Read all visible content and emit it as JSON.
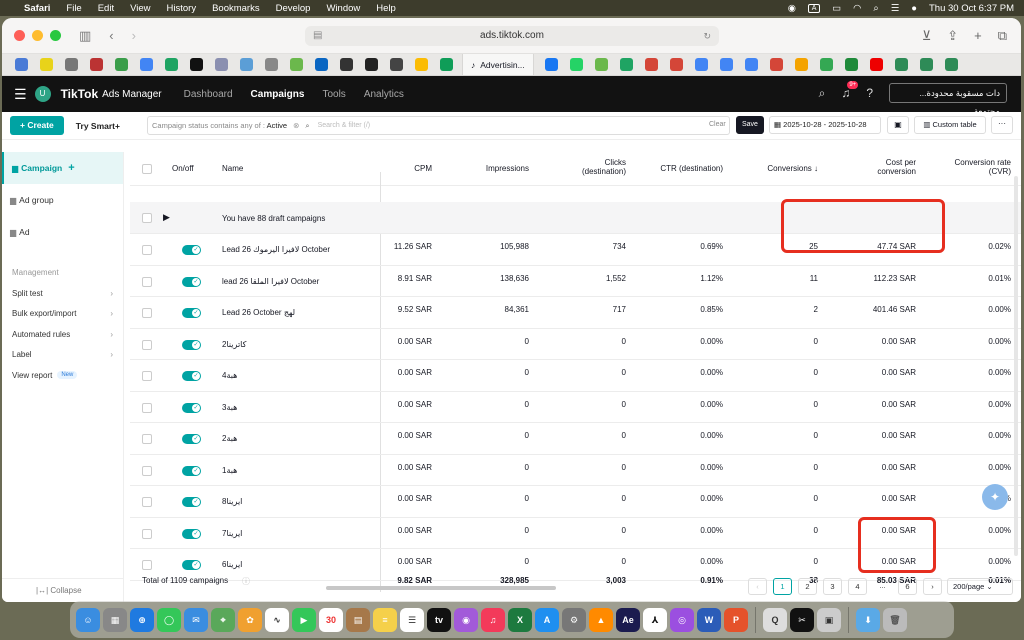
{
  "menubar": {
    "app": "Safari",
    "items": [
      "File",
      "Edit",
      "View",
      "History",
      "Bookmarks",
      "Develop",
      "Window",
      "Help"
    ],
    "datetime": "Thu 30 Oct  6:37 PM"
  },
  "browser": {
    "url": "ads.tiktok.com",
    "active_tab": "Advertisin..."
  },
  "header": {
    "avatar_letter": "U",
    "logo": "TikTok",
    "logo_sub": "Ads Manager",
    "nav": [
      "Dashboard",
      "Campaigns",
      "Tools",
      "Analytics"
    ],
    "notif_badge": "9+",
    "account": "...دات مسقوبة محدودة محتمعة"
  },
  "filterbar": {
    "create": "+ Create",
    "smart": "Try Smart+",
    "filter_label": "Campaign status contains any of : ",
    "filter_value": "Active",
    "search_placeholder": "Search & filter (/)",
    "clear": "Clear",
    "save": "Save",
    "date_range": "2025-10-28  -  2025-10-28",
    "custom_table": "Custom table",
    "more": "···"
  },
  "sidebar": {
    "levels": [
      "Campaign",
      "Ad group",
      "Ad"
    ],
    "management_title": "Management",
    "management": [
      {
        "label": "Split test",
        "chevron": true
      },
      {
        "label": "Bulk export/import",
        "chevron": true
      },
      {
        "label": "Automated rules",
        "chevron": true
      },
      {
        "label": "Label",
        "chevron": true
      },
      {
        "label": "View report",
        "chevron": false,
        "tag": "New"
      }
    ],
    "collapse": "Collapse"
  },
  "table": {
    "headers": {
      "onoff": "On/off",
      "name": "Name",
      "cpm": "CPM",
      "impressions": "Impressions",
      "clicks_l1": "Clicks",
      "clicks_l2": "(destination)",
      "ctr": "CTR (destination)",
      "conversions": "Conversions ↓",
      "cpc_l1": "Cost per",
      "cpc_l2": "conversion",
      "cvr_l1": "Conversion rate",
      "cvr_l2": "(CVR)"
    },
    "draft": "You have 88 draft campaigns",
    "rows": [
      {
        "name": "Lead 26 لافيرا اليرموك October",
        "cpm": "11.26 SAR",
        "impressions": "105,988",
        "clicks": "734",
        "ctr": "0.69%",
        "conversions": "25",
        "cost": "47.74 SAR",
        "cvr": "0.02%"
      },
      {
        "name": "lead 26 لافيرا الملقا October",
        "cpm": "8.91 SAR",
        "impressions": "138,636",
        "clicks": "1,552",
        "ctr": "1.12%",
        "conversions": "11",
        "cost": "112.23 SAR",
        "cvr": "0.01%"
      },
      {
        "name": "Lead 26 October لهج",
        "cpm": "9.52 SAR",
        "impressions": "84,361",
        "clicks": "717",
        "ctr": "0.85%",
        "conversions": "2",
        "cost": "401.46 SAR",
        "cvr": "0.00%"
      },
      {
        "name": "كاترينا2",
        "cpm": "0.00 SAR",
        "impressions": "0",
        "clicks": "0",
        "ctr": "0.00%",
        "conversions": "0",
        "cost": "0.00 SAR",
        "cvr": "0.00%"
      },
      {
        "name": "هبة4",
        "cpm": "0.00 SAR",
        "impressions": "0",
        "clicks": "0",
        "ctr": "0.00%",
        "conversions": "0",
        "cost": "0.00 SAR",
        "cvr": "0.00%"
      },
      {
        "name": "هبة3",
        "cpm": "0.00 SAR",
        "impressions": "0",
        "clicks": "0",
        "ctr": "0.00%",
        "conversions": "0",
        "cost": "0.00 SAR",
        "cvr": "0.00%"
      },
      {
        "name": "هبة2",
        "cpm": "0.00 SAR",
        "impressions": "0",
        "clicks": "0",
        "ctr": "0.00%",
        "conversions": "0",
        "cost": "0.00 SAR",
        "cvr": "0.00%"
      },
      {
        "name": "هبة1",
        "cpm": "0.00 SAR",
        "impressions": "0",
        "clicks": "0",
        "ctr": "0.00%",
        "conversions": "0",
        "cost": "0.00 SAR",
        "cvr": "0.00%"
      },
      {
        "name": "ايرينا8",
        "cpm": "0.00 SAR",
        "impressions": "0",
        "clicks": "0",
        "ctr": "0.00%",
        "conversions": "0",
        "cost": "0.00 SAR",
        "cvr": "0.00%"
      },
      {
        "name": "ايرينا7",
        "cpm": "0.00 SAR",
        "impressions": "0",
        "clicks": "0",
        "ctr": "0.00%",
        "conversions": "0",
        "cost": "0.00 SAR",
        "cvr": "0.00%"
      },
      {
        "name": "ايرينا6",
        "cpm": "0.00 SAR",
        "impressions": "0",
        "clicks": "0",
        "ctr": "0.00%",
        "conversions": "0",
        "cost": "0.00 SAR",
        "cvr": "0.00%"
      }
    ],
    "total": {
      "name": "Total of 1109 campaigns",
      "cpm": "9.82 SAR",
      "impressions": "328,985",
      "clicks": "3,003",
      "ctr": "0.91%",
      "conversions": "38",
      "cost": "85.03 SAR",
      "cvr": "0.01%"
    }
  },
  "pagination": {
    "prev": "‹",
    "pages": [
      "1",
      "2",
      "3",
      "4",
      "...",
      "6"
    ],
    "next": "›",
    "per_page": "200/page"
  },
  "colors": {
    "accent": "#00a3a3",
    "highlight": "#e62e1f",
    "header_bg": "#121212"
  }
}
